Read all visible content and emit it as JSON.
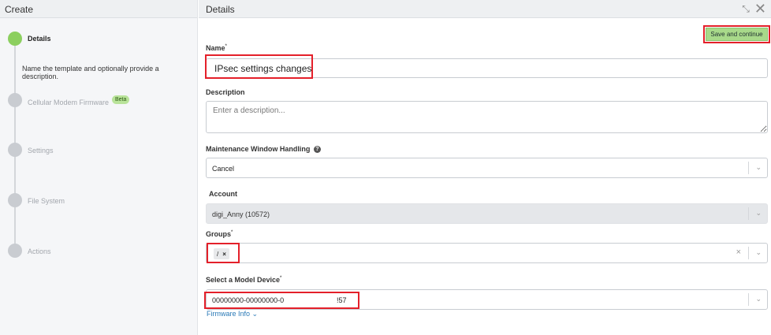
{
  "left_header": {
    "title": "Create"
  },
  "right_header": {
    "title": "Details"
  },
  "steps": [
    {
      "label": "Details",
      "description": "Name the template and optionally provide a description."
    },
    {
      "label": "Cellular Modem Firmware",
      "badge": "Beta"
    },
    {
      "label": "Settings"
    },
    {
      "label": "File System"
    },
    {
      "label": "Actions"
    }
  ],
  "toolbar": {
    "save_label": "Save and continue"
  },
  "form": {
    "name": {
      "label": "Name",
      "required_mark": "*",
      "value": "IPsec settings changes"
    },
    "description": {
      "label": "Description",
      "placeholder": "Enter a description..."
    },
    "maintenance": {
      "label": "Maintenance Window Handling",
      "help_icon": "?",
      "value": "Cancel"
    },
    "account": {
      "label": "Account",
      "value": "digi_Anny (10572)"
    },
    "groups": {
      "label": "Groups",
      "required_mark": "*",
      "tag": "/",
      "tag_remove": "×",
      "clear": "×"
    },
    "model": {
      "label": "Select a Model Device",
      "required_mark": "*",
      "value": "00000000-00000000-0",
      "value_suffix": "!57"
    }
  },
  "firmware_link": {
    "label": "Firmware Info",
    "chevron": "⌄"
  },
  "icons": {
    "minimize": "⤡",
    "close": "✕",
    "chevron": "⌄"
  },
  "colors": {
    "accent_green": "#8ccf5f",
    "highlight_red": "#e4202a",
    "link_blue": "#2a7ab7"
  }
}
